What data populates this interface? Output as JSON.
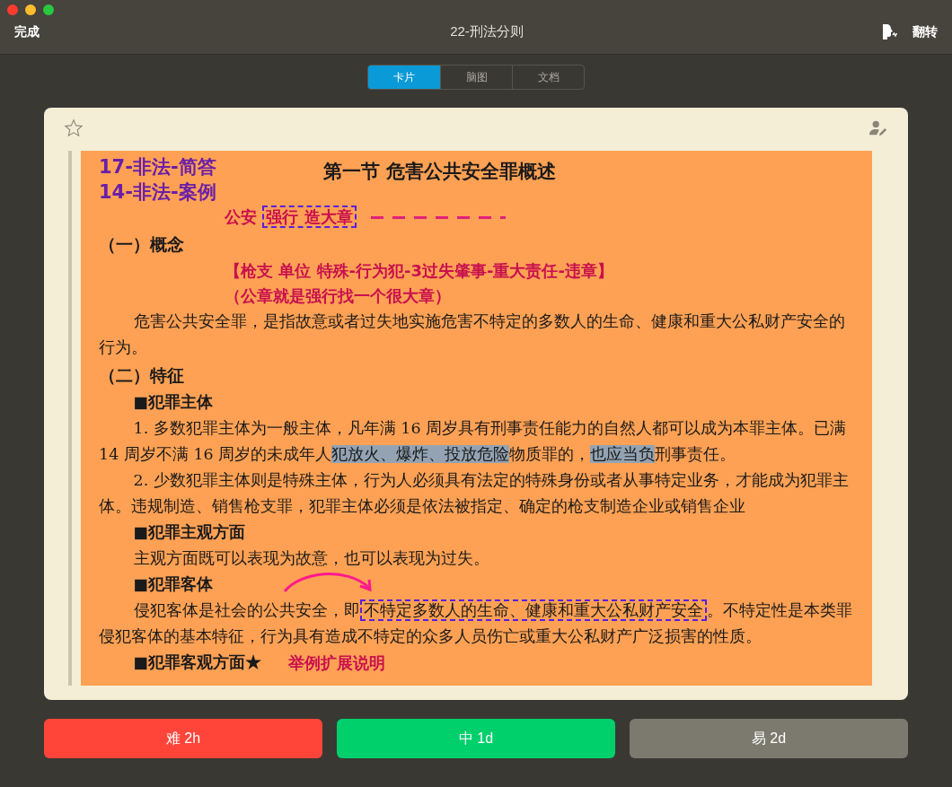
{
  "window": {
    "title": "22-刑法分则",
    "left_action": "完成",
    "right_action": "翻转"
  },
  "tabs": [
    {
      "label": "卡片",
      "selected": true
    },
    {
      "label": "脑图",
      "selected": false
    },
    {
      "label": "文档",
      "selected": false
    }
  ],
  "card": {
    "starred": false,
    "document": {
      "title": "第一节  危害公共安全罪概述",
      "tags": [
        "17-非法-简答",
        "14-非法-案例"
      ],
      "blocks": [
        {
          "kind": "note",
          "segments": [
            {
              "text": "公安 ",
              "boxed": false
            },
            {
              "text": "强行 造大章",
              "boxed": true
            }
          ]
        },
        {
          "kind": "heading",
          "segments": [
            {
              "text": "（一）概念"
            }
          ]
        },
        {
          "kind": "note",
          "segments": [
            {
              "text": "【枪支 单位 特殊-行为犯-3过失肇事-重大责任-违章】"
            }
          ]
        },
        {
          "kind": "note",
          "segments": [
            {
              "text": "（公章就是强行找一个很大章）"
            }
          ]
        },
        {
          "kind": "para",
          "segments": [
            {
              "text": "危害公共安全罪，是指故意或者过失地实施危害不特定的多数人的生命、健康和重大公私财产安全的行为。"
            }
          ]
        },
        {
          "kind": "heading",
          "segments": [
            {
              "text": "（二）特征"
            }
          ]
        },
        {
          "kind": "subheading",
          "segments": [
            {
              "text": "■犯罪主体"
            }
          ]
        },
        {
          "kind": "para",
          "segments": [
            {
              "text": "1. 多数犯罪主体为一般主体，凡年满 16 周岁具有刑事责任能力的自然人都可以成为本罪主体。已满 14 周岁不满 16 周岁的未成年人",
              "highlighted": false
            },
            {
              "text": "犯放火、爆炸、投放危险",
              "highlighted": true
            },
            {
              "text": "物质罪的，",
              "highlighted": false
            },
            {
              "text": "也应当负",
              "highlighted": true
            },
            {
              "text": "刑事责任。",
              "highlighted": false
            }
          ]
        },
        {
          "kind": "para",
          "segments": [
            {
              "text": "2. 少数犯罪主体则是特殊主体，行为人必须具有法定的特殊身份或者从事特定业务，才能成为犯罪主体。违规制造、销售枪支罪，犯罪主体必须是依法被指定、确定的枪支制造企业或销售企业"
            }
          ]
        },
        {
          "kind": "subheading",
          "segments": [
            {
              "text": "■犯罪主观方面"
            }
          ]
        },
        {
          "kind": "para",
          "segments": [
            {
              "text": "主观方面既可以表现为故意，也可以表现为过失。"
            }
          ]
        },
        {
          "kind": "subheading",
          "segments": [
            {
              "text": "■犯罪客体"
            }
          ]
        },
        {
          "kind": "para",
          "segments": [
            {
              "text": "侵犯客体是社会的公共安全，即",
              "boxed": false
            },
            {
              "text": "不特定多数人的生命、健康和重大公私财产安全",
              "boxed": true
            },
            {
              "text": "。不特定性是本类罪侵犯客体的基本特征，行为具有造成不特定的众多人员伤亡或重大公私财产广泛损害的性质。",
              "boxed": false
            }
          ]
        },
        {
          "kind": "subheading",
          "segments": [
            {
              "text": "■犯罪客观方面★"
            }
          ],
          "note": "举例扩展说明"
        }
      ]
    }
  },
  "answers": [
    {
      "label": "难 2h",
      "color": "#ff453a"
    },
    {
      "label": "中 1d",
      "color": "#00d06c"
    },
    {
      "label": "易 2d",
      "color": "#7c7a6e"
    }
  ]
}
